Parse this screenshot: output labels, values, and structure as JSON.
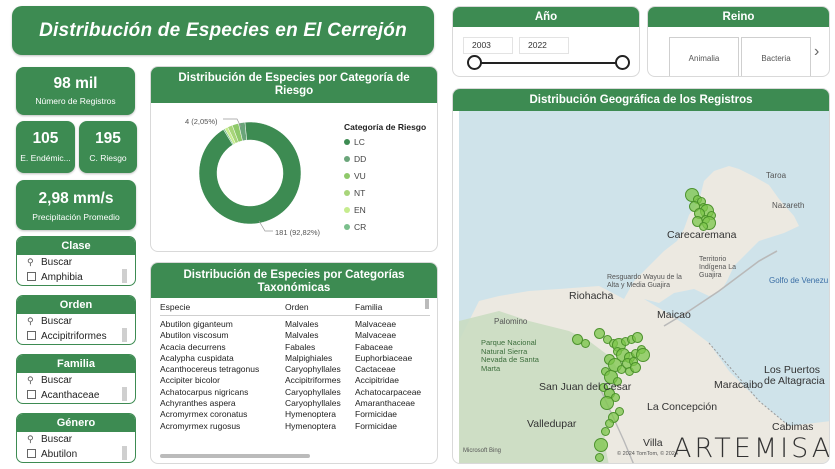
{
  "title": "Distribución de Especies en El Cerrejón",
  "kpis": {
    "registros": {
      "value": "98 mil",
      "label": "Número de Registros"
    },
    "endemicas": {
      "value": "105",
      "label": "E. Endémic..."
    },
    "riesgo": {
      "value": "195",
      "label": "C. Riesgo"
    },
    "precipitacion": {
      "value": "2,98 mm/s",
      "label": "Precipitación Promedio"
    }
  },
  "slicers": [
    {
      "title": "Clase",
      "search": "Buscar",
      "first_item": "Amphibia"
    },
    {
      "title": "Orden",
      "search": "Buscar",
      "first_item": "Accipitriformes"
    },
    {
      "title": "Familia",
      "search": "Buscar",
      "first_item": "Acanthaceae"
    },
    {
      "title": "Género",
      "search": "Buscar",
      "first_item": "Abutilon"
    }
  ],
  "risk_chart": {
    "title": "Distribución de Especies por Categoría de Riesgo",
    "legend_title": "Categoría de Riesgo",
    "top_label": "4 (2,05%)",
    "bottom_label": "181 (92,82%)"
  },
  "chart_data": {
    "type": "pie",
    "title": "Distribución de Especies por Categoría de Riesgo",
    "categories": [
      "LC",
      "DD",
      "VU",
      "NT",
      "EN",
      "CR"
    ],
    "values": [
      181,
      4,
      4,
      3,
      2,
      1
    ],
    "colors": [
      "#3d8b52",
      "#6aa57a",
      "#8fc96a",
      "#a8d57a",
      "#c6ec8e",
      "#7bbf8c"
    ]
  },
  "tax_table": {
    "title": "Distribución de Especies por Categorías Taxonómicas",
    "headers": [
      "Especie",
      "Orden",
      "Familia"
    ],
    "rows": [
      [
        "Abutilon giganteum",
        "Malvales",
        "Malvaceae"
      ],
      [
        "Abutilon viscosum",
        "Malvales",
        "Malvaceae"
      ],
      [
        "Acacia decurrens",
        "Fabales",
        "Fabaceae"
      ],
      [
        "Acalypha cuspidata",
        "Malpighiales",
        "Euphorbiaceae"
      ],
      [
        "Acanthocereus tetragonus",
        "Caryophyllales",
        "Cactaceae"
      ],
      [
        "Accipiter bicolor",
        "Accipitriformes",
        "Accipitridae"
      ],
      [
        "Achatocarpus nigricans",
        "Caryophyllales",
        "Achatocarpaceae"
      ],
      [
        "Achyranthes aspera",
        "Caryophyllales",
        "Amaranthaceae"
      ],
      [
        "Acromyrmex coronatus",
        "Hymenoptera",
        "Formicidae"
      ],
      [
        "Acromyrmex rugosus",
        "Hymenoptera",
        "Formicidae"
      ]
    ]
  },
  "year_slicer": {
    "title": "Año",
    "start": "2003",
    "end": "2022"
  },
  "reino_slicer": {
    "title": "Reino",
    "items": [
      "Animalia",
      "Bacteria"
    ],
    "next_icon": "chevron-right-icon"
  },
  "map": {
    "title": "Distribución Geográfica de los Registros",
    "labels": {
      "taroa": "Taroa",
      "nazareth": "Nazareth",
      "carecaremana": "Carecaremana",
      "territorio": "Territorio\nIndígena La\nGuajira",
      "resguardo": "Resguardo Wayuu de la\nAlta y Media Guajira",
      "riohacha": "Riohacha",
      "golfo": "Golfo de Venezu",
      "palomino": "Palomino",
      "parque": "Parque Nacional\nNatural Sierra\nNevada de Santa\nMarta",
      "maicao": "Maicao",
      "san_juan": "San Juan del Cesar",
      "maracaibo": "Maracaibo",
      "puertos": "Los Puertos\nde Altagracia",
      "concepcion": "La Concepción",
      "valledupar": "Valledupar",
      "cabimas": "Cabimas",
      "villa": "Villa",
      "attribution": "© 2024 TomTom, © 2024",
      "bing": "Microsoft Bing"
    }
  },
  "brand": "ARTEMISA"
}
